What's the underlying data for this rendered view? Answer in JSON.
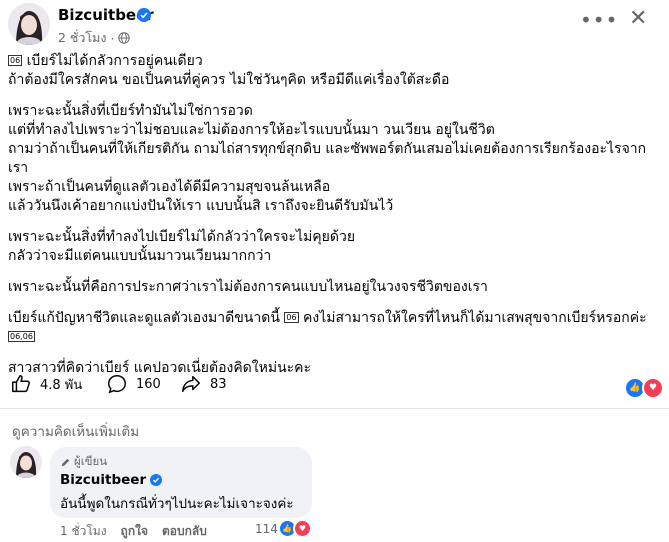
{
  "post": {
    "author": "Bizcuitbeer",
    "time": "2 ชั่วโมง",
    "lines": [
      "เบียร์ไม่ได้กลัวการอยู่คนเดียว",
      "ถ้าต้องมีใครสักคน ขอเป็นคนที่คู่ควร ไม่ใช่วันๆคิด หรือมีดีแค่เรื่องใต้สะดือ",
      "เพราะฉะนั้นสิ่งที่เบียร์ทำมันไม่ใช่การอวด",
      "แต่ที่ทำลงไปเพราะว่าไม่ชอบและไม่ต้องการให้อะไรแบบนั้นมา วนเวียน อยู่ในชีวิต",
      "ถามว่าถ้าเป็นคนที่ให้เกียรติกัน ถามไถ่สารทุกข์สุกดิบ และซัพพอร์ตกันเสมอไม่เคยต้องการเรียกร้องอะไรจาก",
      "เรา",
      "เพราะถ้าเป็นคนที่ดูแลตัวเองได้ดีมีความสุขจนล้นเหลือ",
      "แล้ววันนึงเค้าอยากแบ่งปันให้เรา แบบนั้นสิ เราถึงจะยินดีรับมันไว้",
      "เพราะฉะนั้นสิ่งที่ทำลงไปเบียร์ไม่ได้กลัวว่าใครจะไม่คุยด้วย",
      "กลัวว่าจะมีแต่คนแบบนั้นมาวนเวียนมากกว่า",
      "เพราะฉะนั้นที่คือการประกาศว่าเราไม่ต้องการคนแบบไหนอยู่ในวงจรชีวิตของเรา",
      "เบียร์แก้ปัญหาชีวิตและดูแลตัวเองมาดีขนาดนี้",
      "คงไม่สามารถให้ใครที่ไหนก็ได้มาเสพสุขจากเบียร์หรอกค่ะ",
      "สาวสาวที่คิดว่าเบียร์ แคปอวดเนี่ยต้องคิดใหม่นะคะ"
    ],
    "emoji_text": "06,06"
  },
  "stats": {
    "likes": "4.8 พัน",
    "comments": "160",
    "shares": "83"
  },
  "comments_section": {
    "more_comments_label": "ดูความคิดเห็นเพิ่มเติม",
    "comment": {
      "author_tag": "ผู้เขียน",
      "author": "Bizcuitbeer",
      "text": "อันนี้พูดในกรณีทั่วๆไปนะคะไม่เจาะจงค่ะ",
      "time": "1 ชั่วโมง",
      "like_label": "ถูกใจ",
      "reply_label": "ตอบกลับ",
      "reaction_count": "114"
    }
  },
  "colors": {
    "accent": "#1877f2",
    "love": "#f33e58",
    "muted": "#65676b"
  }
}
